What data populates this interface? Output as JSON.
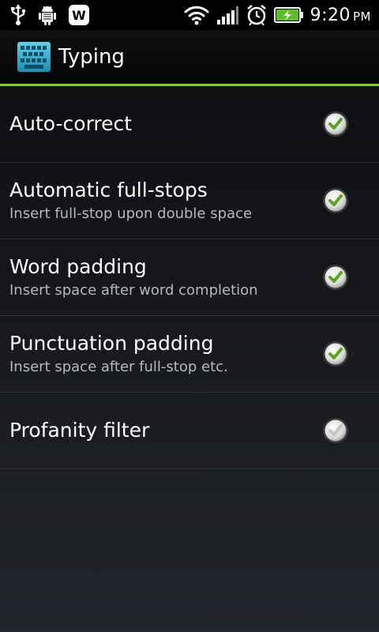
{
  "status_bar": {
    "time": "9:20",
    "ampm": "PM",
    "icons": [
      "usb-icon",
      "android-debug-icon",
      "app-w-icon",
      "wifi-icon",
      "signal-icon",
      "alarm-icon",
      "battery-charging-icon"
    ],
    "app_badge_letter": "W"
  },
  "header": {
    "title": "Typing",
    "icon": "keyboard-icon",
    "accent_color": "#8cc63f"
  },
  "settings": [
    {
      "id": "auto-correct",
      "label": "Auto-correct",
      "summary": "",
      "checked": true
    },
    {
      "id": "automatic-full-stops",
      "label": "Automatic full-stops",
      "summary": "Insert full-stop upon double space",
      "checked": true
    },
    {
      "id": "word-padding",
      "label": "Word padding",
      "summary": "Insert space after word completion",
      "checked": true
    },
    {
      "id": "punctuation-padding",
      "label": "Punctuation padding",
      "summary": "Insert space after full-stop etc.",
      "checked": true
    },
    {
      "id": "profanity-filter",
      "label": "Profanity filter",
      "summary": "",
      "checked": false
    }
  ]
}
